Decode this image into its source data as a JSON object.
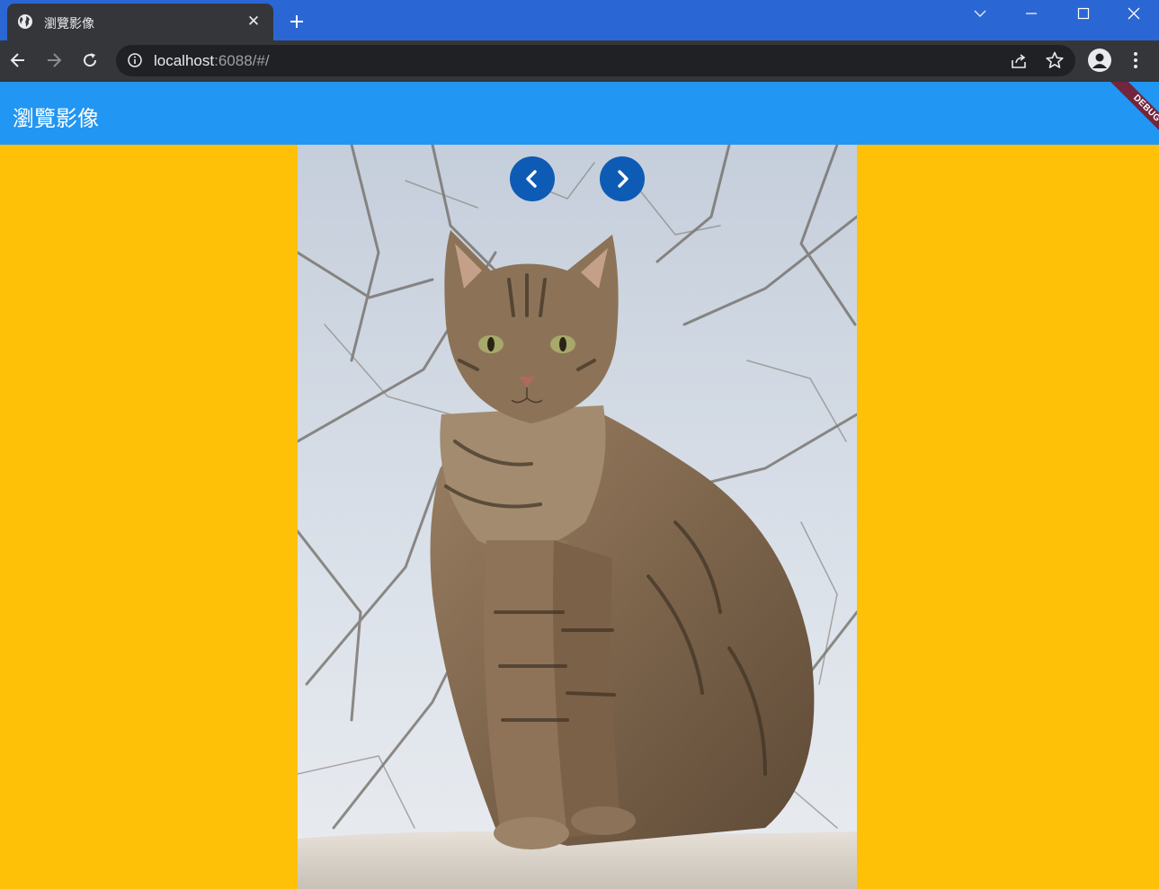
{
  "browser": {
    "tab_title": "瀏覽影像",
    "url_host": "localhost",
    "url_rest": ":6088/#/",
    "icons": {
      "favicon": "globe-icon",
      "tab_close": "close-icon",
      "new_tab": "plus-icon",
      "tab_search": "chevron-down-icon",
      "minimize": "minimize-icon",
      "maximize": "maximize-icon",
      "close_window": "close-icon",
      "back": "arrow-left-icon",
      "forward": "arrow-right-icon",
      "reload": "reload-icon",
      "site_info": "info-icon",
      "share": "share-icon",
      "bookmark": "star-icon",
      "profile": "person-icon",
      "menu": "kebab-menu-icon"
    }
  },
  "app": {
    "title": "瀏覽影像",
    "debug_banner": "DEBUG",
    "colors": {
      "appbar": "#2196F3",
      "background": "#FFC107",
      "nav_button": "#0D5BB5"
    },
    "viewer": {
      "image_subject": "tabby cat sitting on a stone wall in front of bare branches",
      "prev_icon": "chevron-left-icon",
      "next_icon": "chevron-right-icon"
    }
  }
}
